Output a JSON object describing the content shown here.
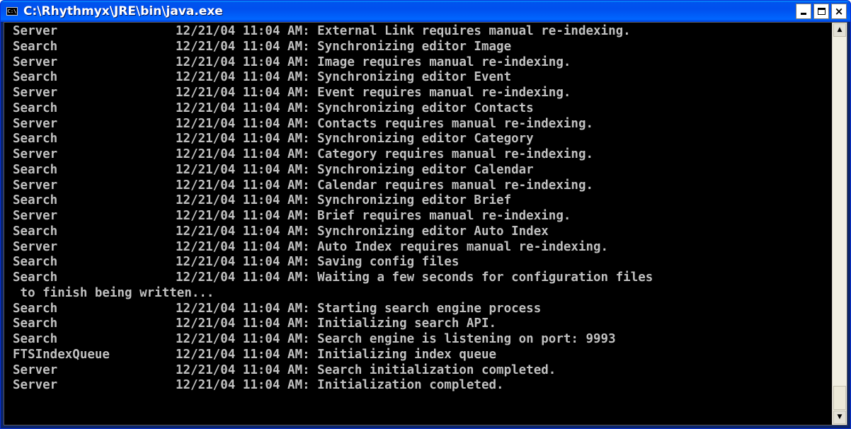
{
  "window": {
    "title": "C:\\Rhythmyx\\JRE\\bin\\java.exe",
    "icon": "console-icon",
    "buttons": {
      "minimize": "minimize-icon",
      "maximize": "maximize-icon",
      "close": "×"
    }
  },
  "console": {
    "lines": [
      {
        "src": "Server",
        "msg": "12/21/04 11:04 AM: External Link requires manual re-indexing."
      },
      {
        "src": "Search",
        "msg": "12/21/04 11:04 AM: Synchronizing editor Image"
      },
      {
        "src": "Server",
        "msg": "12/21/04 11:04 AM: Image requires manual re-indexing."
      },
      {
        "src": "Search",
        "msg": "12/21/04 11:04 AM: Synchronizing editor Event"
      },
      {
        "src": "Server",
        "msg": "12/21/04 11:04 AM: Event requires manual re-indexing."
      },
      {
        "src": "Search",
        "msg": "12/21/04 11:04 AM: Synchronizing editor Contacts"
      },
      {
        "src": "Server",
        "msg": "12/21/04 11:04 AM: Contacts requires manual re-indexing."
      },
      {
        "src": "Search",
        "msg": "12/21/04 11:04 AM: Synchronizing editor Category"
      },
      {
        "src": "Server",
        "msg": "12/21/04 11:04 AM: Category requires manual re-indexing."
      },
      {
        "src": "Search",
        "msg": "12/21/04 11:04 AM: Synchronizing editor Calendar"
      },
      {
        "src": "Server",
        "msg": "12/21/04 11:04 AM: Calendar requires manual re-indexing."
      },
      {
        "src": "Search",
        "msg": "12/21/04 11:04 AM: Synchronizing editor Brief"
      },
      {
        "src": "Server",
        "msg": "12/21/04 11:04 AM: Brief requires manual re-indexing."
      },
      {
        "src": "Search",
        "msg": "12/21/04 11:04 AM: Synchronizing editor Auto Index"
      },
      {
        "src": "Server",
        "msg": "12/21/04 11:04 AM: Auto Index requires manual re-indexing."
      },
      {
        "src": "Search",
        "msg": "12/21/04 11:04 AM: Saving config files"
      },
      {
        "src": "Search",
        "msg": "12/21/04 11:04 AM: Waiting a few seconds for configuration files"
      },
      {
        "src": " to finish being written...",
        "msg": ""
      },
      {
        "src": "Search",
        "msg": "12/21/04 11:04 AM: Starting search engine process"
      },
      {
        "src": "Search",
        "msg": "12/21/04 11:04 AM: Initializing search API."
      },
      {
        "src": "Search",
        "msg": "12/21/04 11:04 AM: Search engine is listening on port: 9993"
      },
      {
        "src": "FTSIndexQueue",
        "msg": "12/21/04 11:04 AM: Initializing index queue"
      },
      {
        "src": "Server",
        "msg": "12/21/04 11:04 AM: Search initialization completed."
      },
      {
        "src": "Server",
        "msg": "12/21/04 11:04 AM: Initialization completed."
      }
    ]
  },
  "scrollbar": {
    "up_arrow": "▲",
    "down_arrow": "▼"
  },
  "colors": {
    "console_bg": "#000000",
    "console_text": "#c0c0c0",
    "titlebar": "#0054e3"
  }
}
